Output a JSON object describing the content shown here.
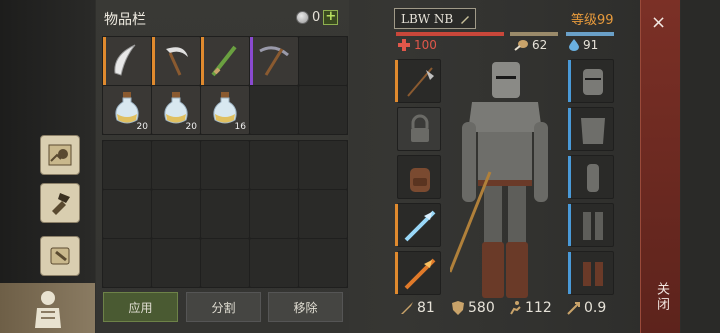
{
  "inventory": {
    "title": "物品栏",
    "coins": "0",
    "add_label": "+",
    "items": [
      {
        "name": "curved-blade-icon",
        "rarity": "#e08a2e",
        "count": ""
      },
      {
        "name": "sickle-icon",
        "rarity": "#e08a2e",
        "count": ""
      },
      {
        "name": "green-dagger-icon",
        "rarity": "#e08a2e",
        "count": ""
      },
      {
        "name": "pickaxe-icon",
        "rarity": "#8a4ad0",
        "count": ""
      },
      {
        "name": "potion-icon",
        "rarity": "",
        "count": "20"
      },
      {
        "name": "potion-icon",
        "rarity": "",
        "count": "20"
      },
      {
        "name": "potion-icon",
        "rarity": "",
        "count": "16"
      }
    ],
    "buttons": {
      "apply": "应用",
      "split": "分割",
      "remove": "移除"
    }
  },
  "sidebar": {
    "items": [
      "map-icon",
      "crafting-icon",
      "scroll-icon",
      "character-icon"
    ]
  },
  "character": {
    "name": "LBW NB",
    "level": "等级99",
    "hp": "100",
    "hunger": "62",
    "water": "91",
    "stats": {
      "damage": "81",
      "armor": "580",
      "speed": "112",
      "attack_speed": "0.9"
    }
  },
  "close": {
    "x": "×",
    "label": "关闭"
  },
  "colors": {
    "orange": "#e08a2e",
    "purple": "#8a4ad0",
    "blue": "#4a9ad8",
    "red": "#e04a3a",
    "close_bg": "#6a2820"
  }
}
